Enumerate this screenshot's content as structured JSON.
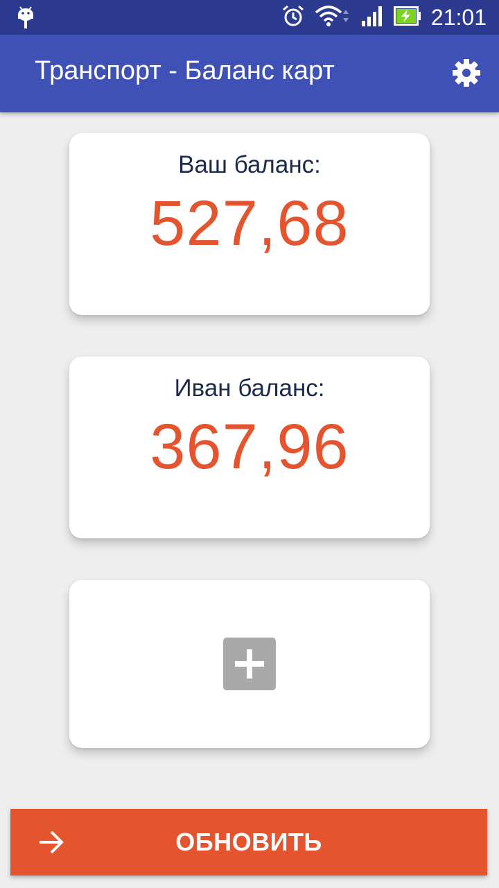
{
  "status_bar": {
    "time": "21:01",
    "icons": [
      "android-icon",
      "alarm-icon",
      "wifi-icon",
      "signal-icon",
      "battery-charging-icon"
    ]
  },
  "app_bar": {
    "title": "Транспорт - Баланс карт",
    "settings_icon": "gear-icon"
  },
  "cards": [
    {
      "label": "Ваш баланс:",
      "value": "527,68"
    },
    {
      "label": "Иван баланс:",
      "value": "367,96"
    }
  ],
  "add_card": {
    "icon": "plus-icon"
  },
  "refresh_button": {
    "label": "ОБНОВИТЬ",
    "icon": "arrow-right-icon"
  },
  "colors": {
    "status_bar": "#2c3a8f",
    "app_bar": "#3f51b5",
    "accent": "#e4552f",
    "background": "#eeeeee"
  }
}
